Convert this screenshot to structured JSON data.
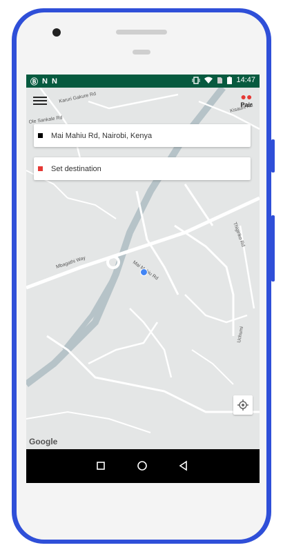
{
  "status_bar": {
    "left_icons": [
      "b-circle-icon",
      "n-notification-icon",
      "n-notification-icon"
    ],
    "left_glyphs": [
      "Ⓑ",
      "N",
      "N"
    ],
    "time": "14:47"
  },
  "header": {
    "pair_label": "Pair"
  },
  "map_labels": [
    {
      "text": "Karuri Gakure Rd"
    },
    {
      "text": "Kisauni Rd"
    },
    {
      "text": "Ole Sankale Rd"
    },
    {
      "text": "Mbagathi Way"
    },
    {
      "text": "Mai Mahiu Rd"
    },
    {
      "text": "Thigiriko Rd"
    },
    {
      "text": "Uchumi"
    }
  ],
  "pickup": {
    "address": "Mai Mahiu Rd, Nairobi, Kenya",
    "color": "#000000"
  },
  "destination": {
    "placeholder": "Set destination",
    "color": "#e53935"
  },
  "attribution": "Google",
  "colors": {
    "status_bar": "#075a3f",
    "phone_frame": "#2f4fd8",
    "location_dot": "#4285f4"
  }
}
